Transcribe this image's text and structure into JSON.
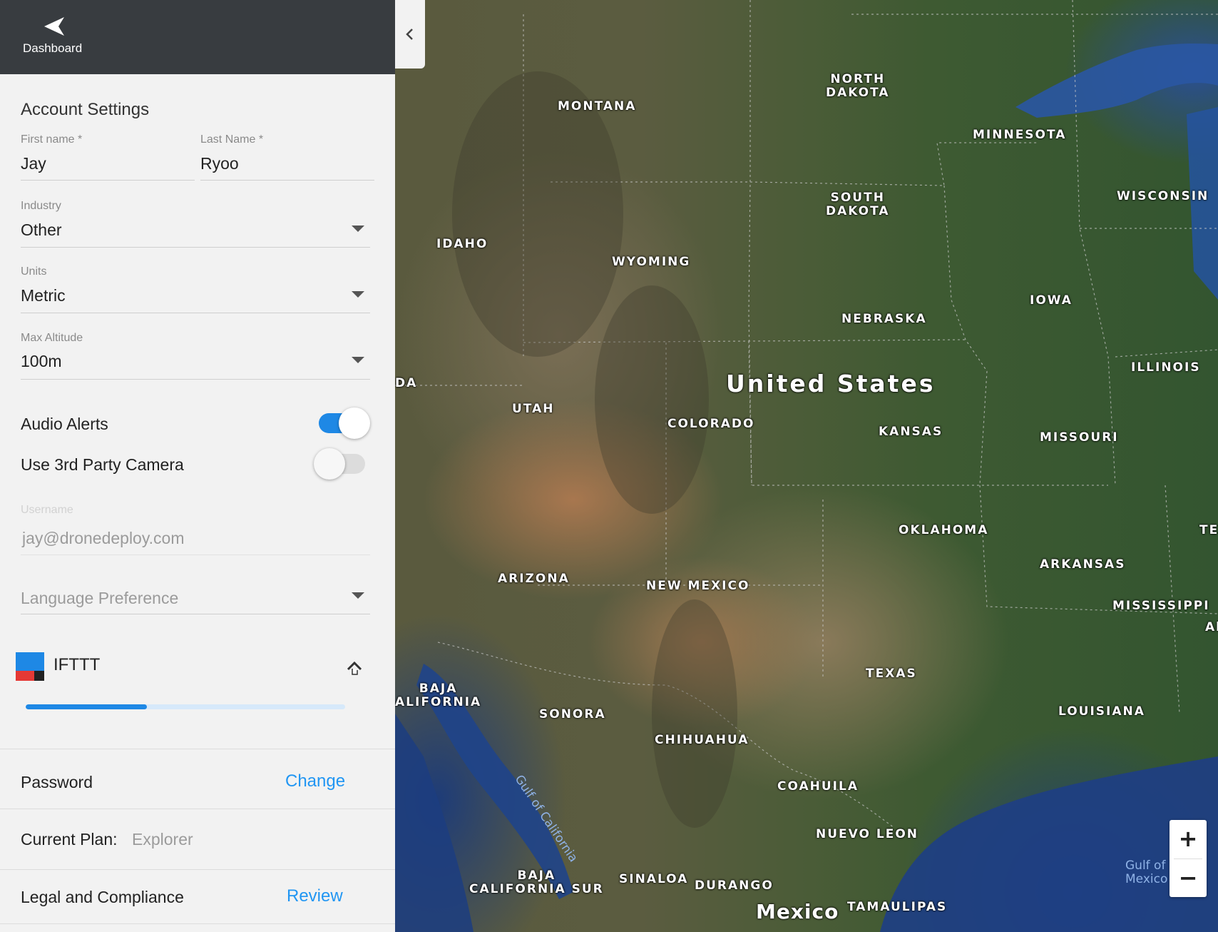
{
  "topbar": {
    "back_label": "Dashboard"
  },
  "account": {
    "title": "Account Settings",
    "first_name": {
      "label": "First name *",
      "value": "Jay"
    },
    "last_name": {
      "label": "Last Name *",
      "value": "Ryoo"
    },
    "industry": {
      "label": "Industry",
      "value": "Other"
    },
    "units": {
      "label": "Units",
      "value": "Metric"
    },
    "max_altitude": {
      "label": "Max Altitude",
      "value": "100m"
    },
    "audio_alerts": {
      "label": "Audio Alerts",
      "enabled": true
    },
    "third_party_camera": {
      "label": "Use 3rd Party Camera",
      "enabled": false
    },
    "username": {
      "label": "Username",
      "value": "jay@dronedeploy.com"
    },
    "language": {
      "placeholder": "Language Preference"
    }
  },
  "integration": {
    "name": "IFTTT",
    "progress_fraction": 0.38,
    "colors": {
      "blue": "#1e88e5",
      "red": "#e53935",
      "dark": "#222222"
    }
  },
  "password": {
    "label": "Password",
    "action": "Change"
  },
  "plan": {
    "label": "Current Plan:",
    "value": "Explorer"
  },
  "legal": {
    "label": "Legal and Compliance",
    "action": "Review"
  },
  "map": {
    "country": "United States",
    "mexico": "Mexico",
    "states": {
      "montana": "MONTANA",
      "north_dakota": "NORTH\nDAKOTA",
      "minnesota": "MINNESOTA",
      "wisconsin": "WISCONSIN",
      "south_dakota": "SOUTH\nDAKOTA",
      "idaho": "IDAHO",
      "wyoming": "WYOMING",
      "iowa": "IOWA",
      "nebraska": "NEBRASKA",
      "illinois": "ILLINOIS",
      "nevada_partial": "DA",
      "utah": "UTAH",
      "colorado": "COLORADO",
      "kansas": "KANSAS",
      "missouri": "MISSOURI",
      "oklahoma": "OKLAHOMA",
      "tennessee_partial": "TE",
      "arkansas": "ARKANSAS",
      "arizona": "ARIZONA",
      "new_mexico": "NEW MEXICO",
      "mississippi": "MISSISSIPPI",
      "alabama_partial": "Al",
      "texas": "TEXAS",
      "baja_california": "BAJA\nALIFORNIA",
      "sonora": "SONORA",
      "louisiana": "LOUISIANA",
      "chihuahua": "CHIHUAHUA",
      "coahuila": "COAHUILA",
      "nuevo_leon": "NUEVO LEON",
      "baja_california_sur": "BAJA\nCALIFORNIA SUR",
      "sinaloa": "SINALOA",
      "durango": "DURANGO",
      "tamaulipas": "TAMAULIPAS"
    },
    "water": {
      "gulf_of_california": "Gulf of California",
      "gulf_of_mexico": "Gulf of\nMexico"
    },
    "zoom_in": "+",
    "zoom_out": "−"
  }
}
